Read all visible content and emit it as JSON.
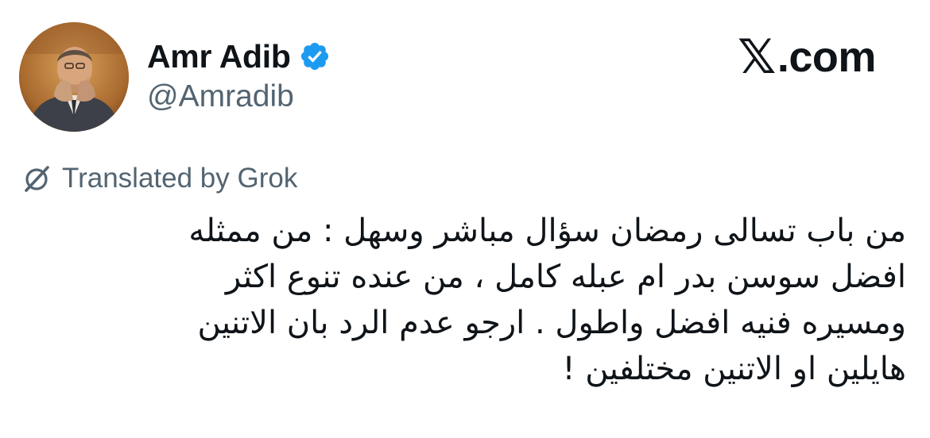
{
  "author": {
    "display_name": "Amr Adib",
    "handle": "@Amradib",
    "verified": true,
    "verified_color": "#1d9bf0"
  },
  "brand": {
    "x_mark": "𝕏",
    "label": ".com"
  },
  "translation": {
    "icon": "grok-icon",
    "label": "Translated by Grok"
  },
  "tweet": {
    "lines": [
      "من باب تسالى رمضان سؤال مباشر وسهل : من ممثله",
      "افضل سوسن بدر ام عبله كامل ، من عنده تنوع اكثر",
      "ومسيره فنيه افضل واطول . ارجو عدم الرد بان الاتنين",
      "هايلين او الاتنين مختلفين !"
    ]
  }
}
